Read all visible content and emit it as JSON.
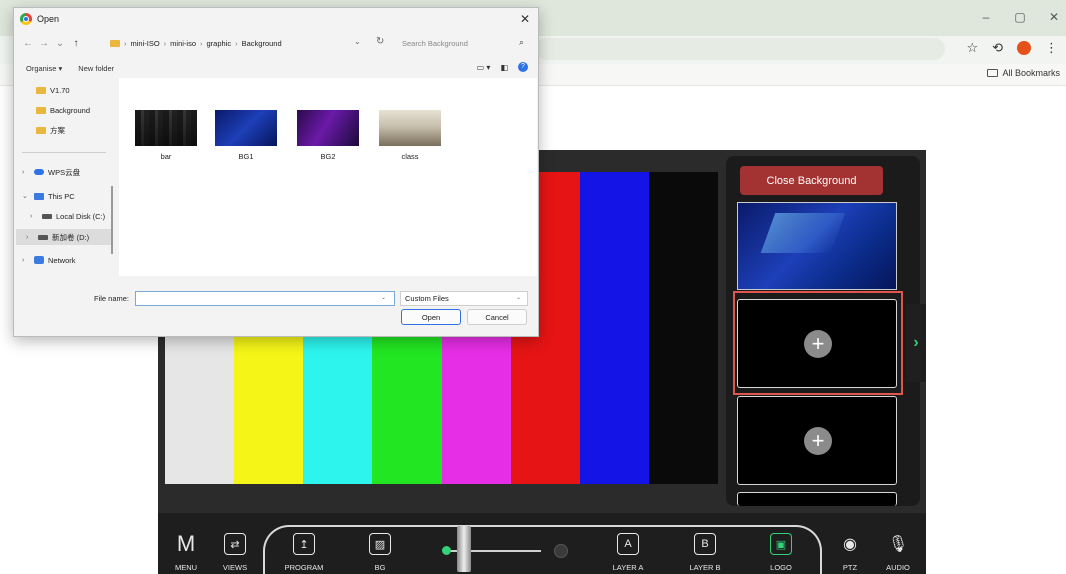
{
  "browser": {
    "window_controls": [
      "–",
      "▢",
      "✕"
    ],
    "toolbar_icons": [
      "☆",
      "⟲",
      "⋮"
    ],
    "bookmarks_label": "All Bookmarks"
  },
  "dialog": {
    "title": "Open",
    "close": "✕",
    "nav": {
      "back": "←",
      "forward": "→",
      "recent": "⌄",
      "up": "↑"
    },
    "breadcrumb": [
      "mini-ISO",
      "mini-iso",
      "graphic",
      "Background"
    ],
    "breadcrumb_sep": "›",
    "search_placeholder": "Search Background",
    "commands": {
      "organise": "Organise",
      "new_folder": "New folder"
    },
    "nav_pane": {
      "quick": [
        "V1.70",
        "Background",
        "方案"
      ],
      "wps": "WPS云盘",
      "this_pc": "This PC",
      "local_disk": "Local Disk (C:)",
      "new_volume": "新加卷 (D:)",
      "network": "Network"
    },
    "files": [
      {
        "name": "bar",
        "thumb": "bar"
      },
      {
        "name": "BG1",
        "thumb": "bg1"
      },
      {
        "name": "BG2",
        "thumb": "bg2"
      },
      {
        "name": "class",
        "thumb": "class"
      }
    ],
    "file_name_label": "File name:",
    "file_name_value": "",
    "file_type": "Custom Files",
    "open_label": "Open",
    "cancel_label": "Cancel"
  },
  "app": {
    "close_background_label": "Close Background",
    "color_bars": [
      "#e6e6e6",
      "#f5f518",
      "#2df5ee",
      "#22e622",
      "#e62ee6",
      "#e61414",
      "#1414e6",
      "#0a0a0a"
    ],
    "top_hidden_bars": [
      "#f5f518",
      "#2df5ee",
      "#22e622",
      "#e62ee6",
      "#e61414",
      "#1414e6",
      "#0a0a0a"
    ],
    "add_symbol": "+",
    "side_arrow": "›",
    "toolbar": [
      {
        "id": "menu",
        "label": "MENU",
        "icon": "M"
      },
      {
        "id": "views",
        "label": "VIEWS",
        "icon": "⇄"
      },
      {
        "id": "program",
        "label": "PROGRAM",
        "icon": "↥"
      },
      {
        "id": "bg",
        "label": "BG",
        "icon": "▨"
      },
      {
        "id": "layer-a",
        "label": "LAYER A",
        "icon": "A"
      },
      {
        "id": "layer-b",
        "label": "LAYER B",
        "icon": "B"
      },
      {
        "id": "logo",
        "label": "LOGO",
        "icon": "▣"
      },
      {
        "id": "ptz",
        "label": "PTZ",
        "icon": "◉"
      },
      {
        "id": "audio",
        "label": "AUDIO",
        "icon": "🎙"
      }
    ],
    "accent": "#33d17a",
    "close_btn_color": "#a33232",
    "selection_color": "#e0554d"
  }
}
